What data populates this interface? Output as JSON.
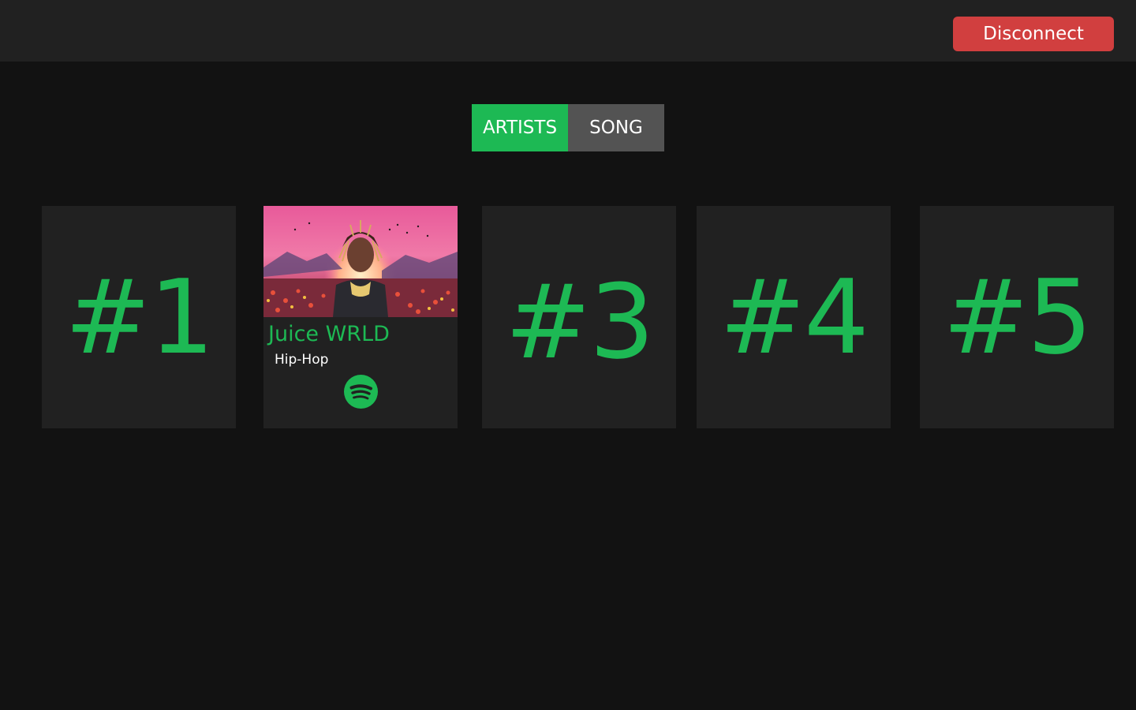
{
  "header": {
    "disconnect_label": "Disconnect"
  },
  "tabs": [
    {
      "label": "ARTISTS",
      "active": true
    },
    {
      "label": "SONG",
      "active": false
    }
  ],
  "cards": [
    {
      "rank_label": "#1"
    },
    {
      "artist_name": "Juice WRLD",
      "genre": "Hip-Hop",
      "link_icon": "spotify-icon"
    },
    {
      "rank_label": "#3"
    },
    {
      "rank_label": "#4"
    },
    {
      "rank_label": "#5"
    }
  ],
  "colors": {
    "accent": "#1db954",
    "background": "#121212",
    "surface": "#212121",
    "danger": "#d13f3f",
    "tab_inactive": "#535353"
  }
}
